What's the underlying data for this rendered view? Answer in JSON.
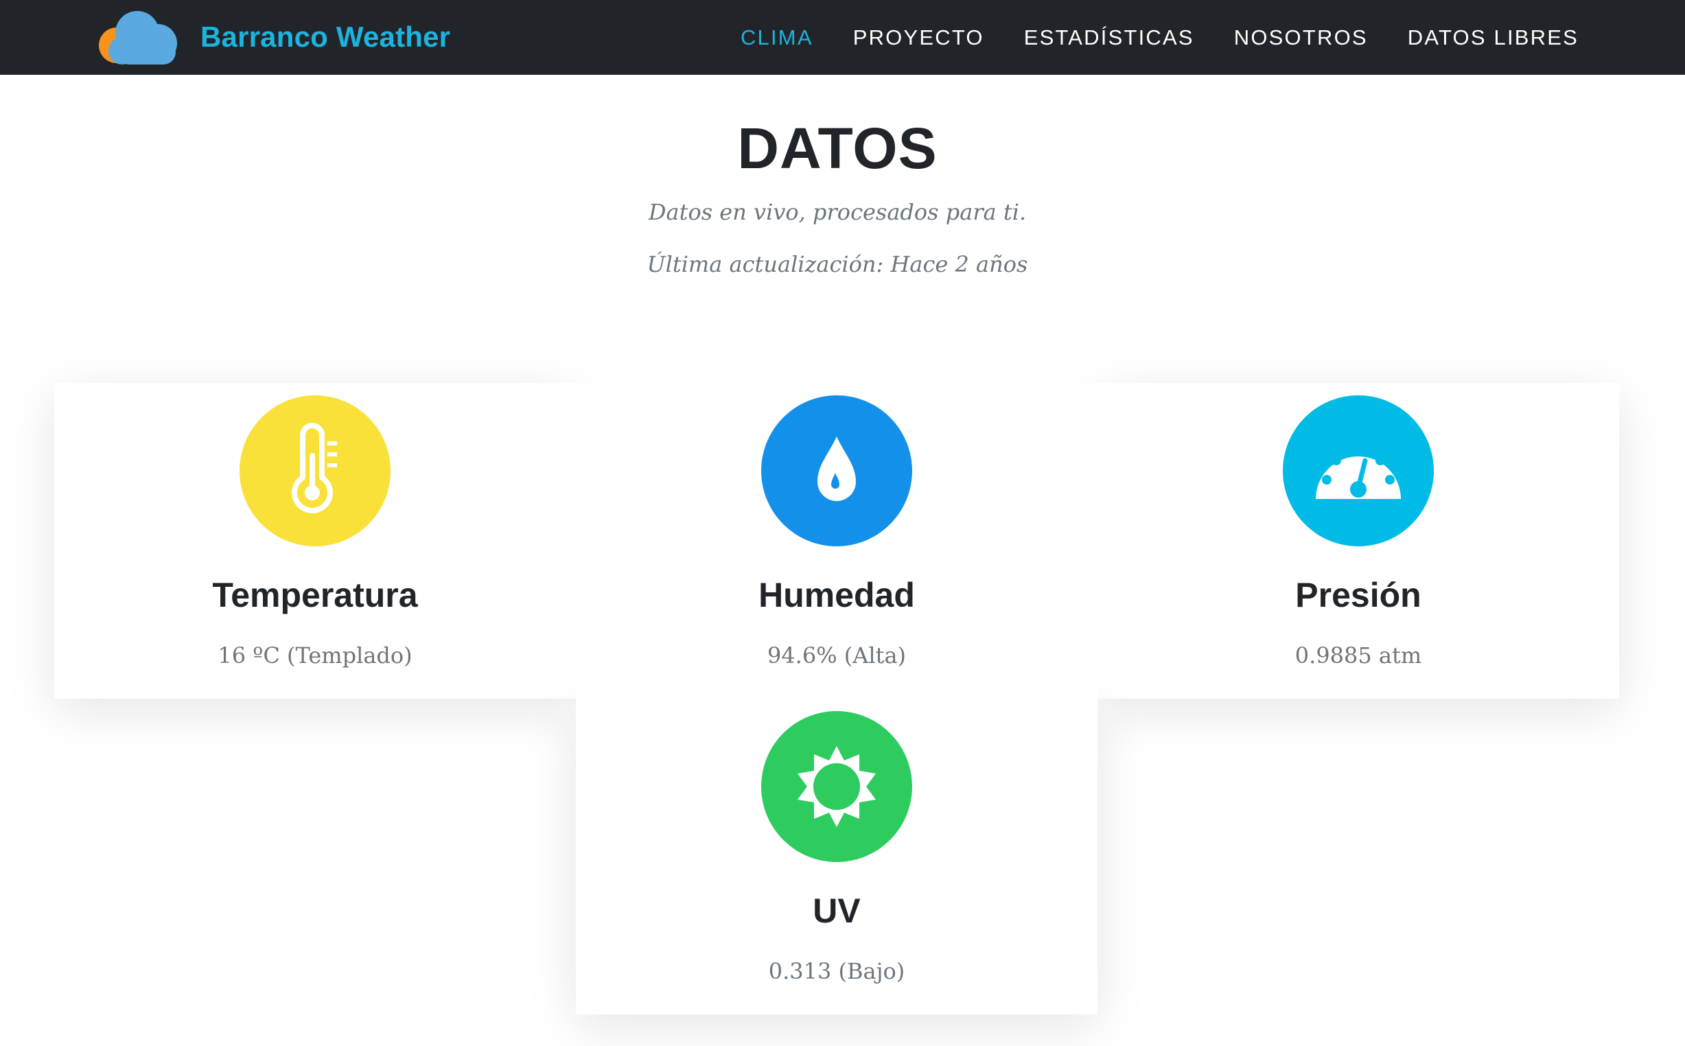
{
  "nav": {
    "brand": "Barranco Weather",
    "links": [
      "CLIMA",
      "PROYECTO",
      "ESTADÍSTICAS",
      "NOSOTROS",
      "DATOS LIBRES"
    ],
    "active": "CLIMA"
  },
  "header": {
    "title": "DATOS",
    "subtitle": "Datos en vivo, procesados para ti.",
    "updated": "Última actualización: Hace 2 años"
  },
  "cards": {
    "temperature": {
      "title": "Temperatura",
      "value": "16 ºC (Templado)",
      "icon": "thermometer-icon",
      "color": "#f9e13a"
    },
    "humidity": {
      "title": "Humedad",
      "value": "94.6% (Alta)",
      "icon": "water-drop-icon",
      "color": "#1391ea"
    },
    "pressure": {
      "title": "Presión",
      "value": "0.9885 atm",
      "icon": "gauge-icon",
      "color": "#00bbe6"
    },
    "uv": {
      "title": "UV",
      "value": "0.313 (Bajo)",
      "icon": "sun-icon",
      "color": "#2ecc5f"
    }
  },
  "colors": {
    "navbar_bg": "#212529",
    "accent": "#1cb4de",
    "logo_cloud": "#5aa9e0",
    "logo_sun": "#f5931e"
  }
}
